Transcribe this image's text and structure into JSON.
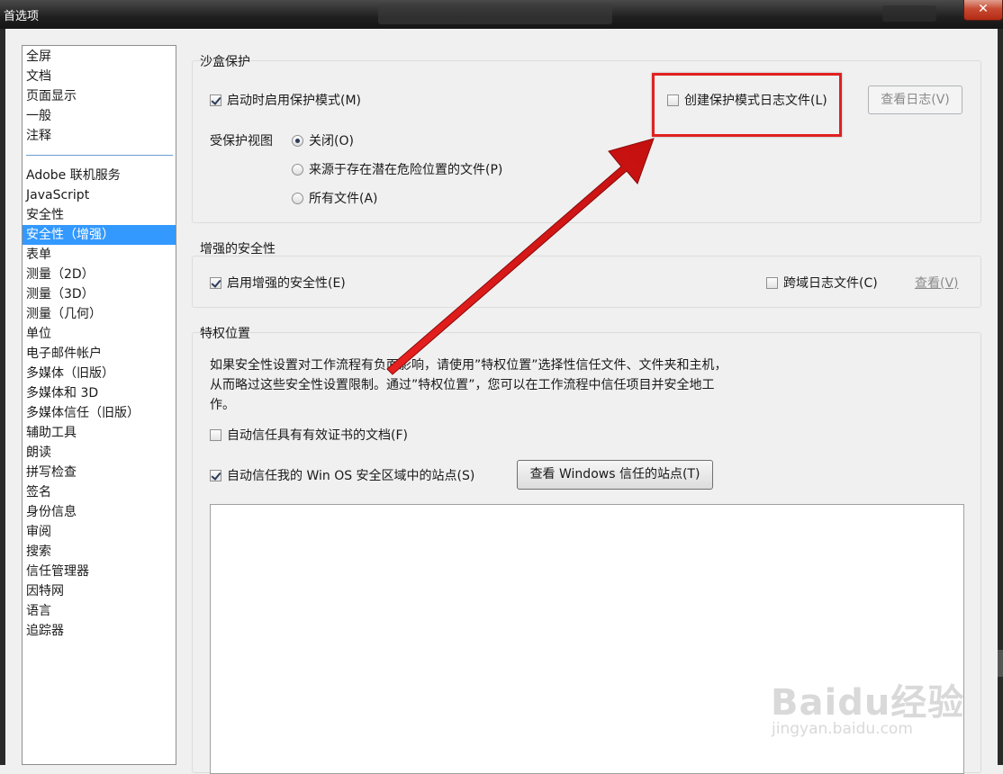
{
  "window": {
    "title": "首选项",
    "close_glyph": "✕"
  },
  "sidebar": {
    "items": [
      "全屏",
      "文档",
      "页面显示",
      "一般",
      "注释",
      "Adobe 联机服务",
      "JavaScript",
      "安全性",
      "安全性（增强）",
      "表单",
      "测量（2D）",
      "测量（3D）",
      "测量（几何）",
      "单位",
      "电子邮件帐户",
      "多媒体（旧版）",
      "多媒体和 3D",
      "多媒体信任（旧版）",
      "辅助工具",
      "朗读",
      "拼写检查",
      "签名",
      "身份信息",
      "审阅",
      "搜索",
      "信任管理器",
      "因特网",
      "语言",
      "追踪器"
    ],
    "selected": "安全性（增强）"
  },
  "sandbox": {
    "title": "沙盒保护",
    "enable_protected_mode": "启动时启用保护模式(M)",
    "create_log": "创建保护模式日志文件(L)",
    "view_log": "查看日志(V)",
    "protected_view_label": "受保护视图",
    "radio_off": "关闭(O)",
    "radio_unsafe": "来源于存在潜在危险位置的文件(P)",
    "radio_all": "所有文件(A)"
  },
  "enhanced": {
    "title": "增强的安全性",
    "enable": "启用增强的安全性(E)",
    "cross_domain": "跨域日志文件(C)",
    "view": "查看(V)"
  },
  "privileged": {
    "title": "特权位置",
    "desc_line1": "如果安全性设置对工作流程有负面影响，请使用”特权位置”选择性信任文件、文件夹和主机，",
    "desc_line2": "从而略过这些安全性设置限制。通过”特权位置”，您可以在工作流程中信任项目并安全地工",
    "desc_line3": "作。",
    "auto_trust_cert": "自动信任具有有效证书的文档(F)",
    "auto_trust_winos": "自动信任我的 Win OS 安全区域中的站点(S)",
    "view_windows_sites": "查看 Windows 信任的站点(T)"
  },
  "watermark": {
    "brand": "Baidu经验",
    "url": "jingyan.baidu.com"
  },
  "colors": {
    "selection": "#3399ff",
    "annotation": "#e02020"
  }
}
